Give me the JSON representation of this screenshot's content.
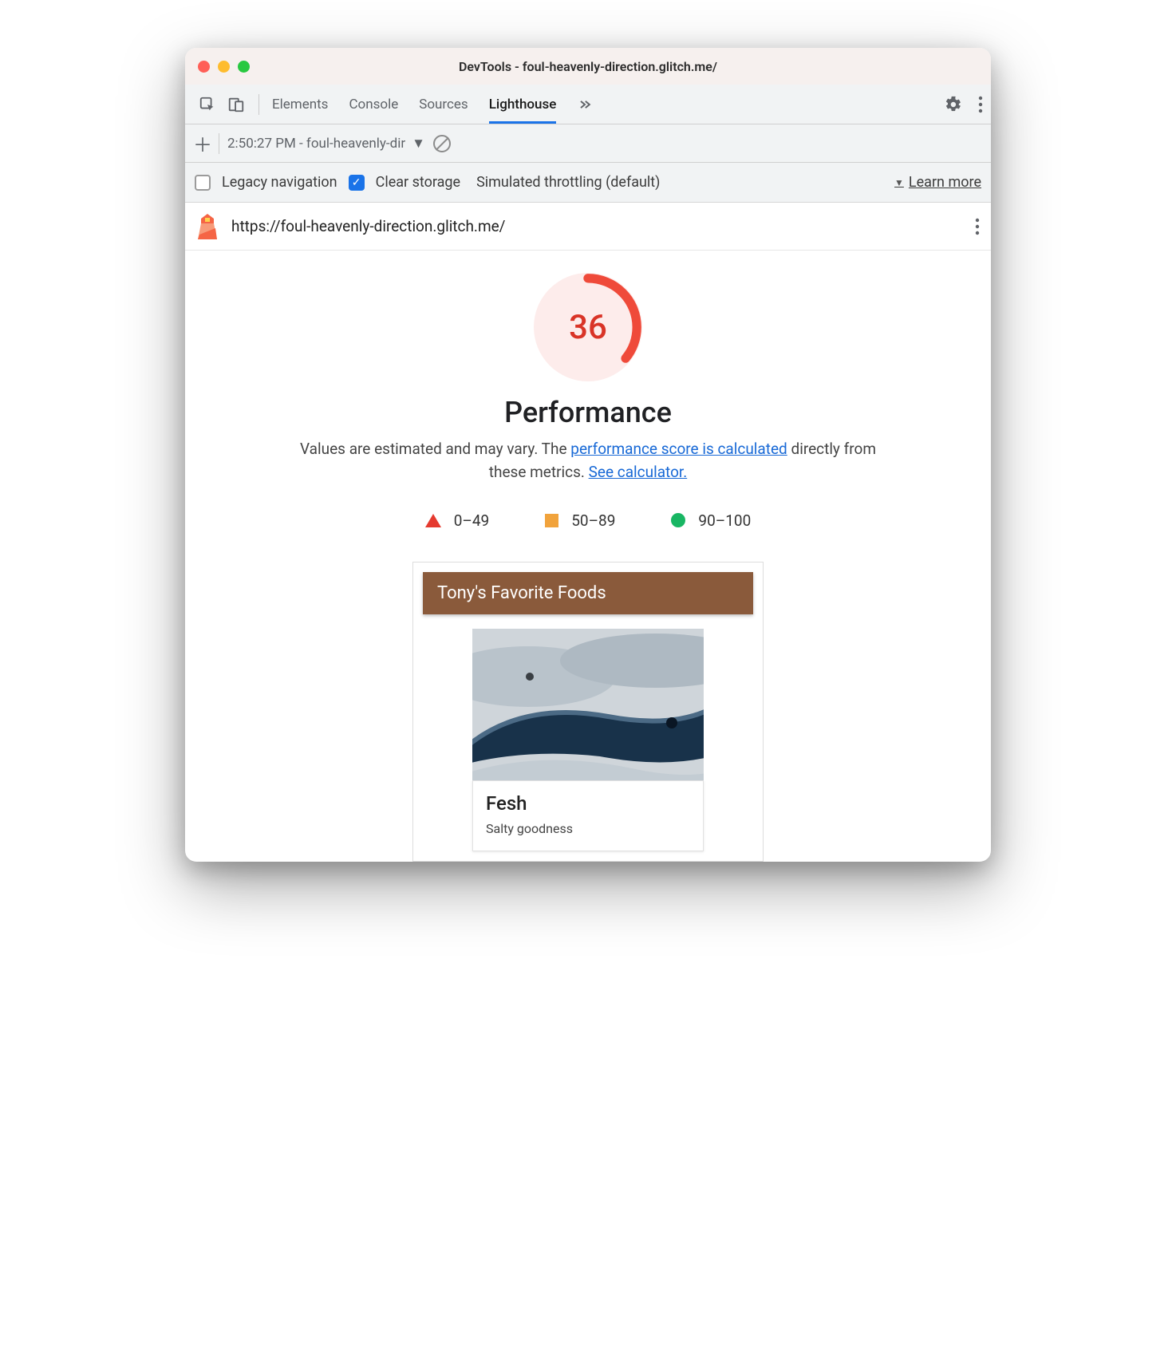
{
  "window": {
    "title": "DevTools - foul-heavenly-direction.glitch.me/"
  },
  "tabs": {
    "items": [
      "Elements",
      "Console",
      "Sources",
      "Lighthouse"
    ],
    "active_index": 3
  },
  "subbar": {
    "history_label": "2:50:27 PM - foul-heavenly-dir"
  },
  "options": {
    "legacy_nav_label": "Legacy navigation",
    "legacy_nav_checked": false,
    "clear_storage_label": "Clear storage",
    "clear_storage_checked": true,
    "throttling_label": "Simulated throttling (default)",
    "learn_more": "Learn more"
  },
  "report": {
    "url": "https://foul-heavenly-direction.glitch.me/",
    "score": "36",
    "score_fraction": 0.36,
    "category_title": "Performance",
    "desc_prefix": "Values are estimated and may vary. The ",
    "desc_link1": "performance score is calculated",
    "desc_mid": " directly from these metrics. ",
    "desc_link2": "See calculator.",
    "legend": {
      "fail": "0–49",
      "avg": "50–89",
      "pass": "90–100"
    },
    "preview": {
      "header": "Tony's Favorite Foods",
      "card_title": "Fesh",
      "card_sub": "Salty goodness"
    },
    "colors": {
      "fail": "#e53a2f",
      "avg": "#f1a33c",
      "pass": "#18b663",
      "link": "#1869d6"
    }
  }
}
